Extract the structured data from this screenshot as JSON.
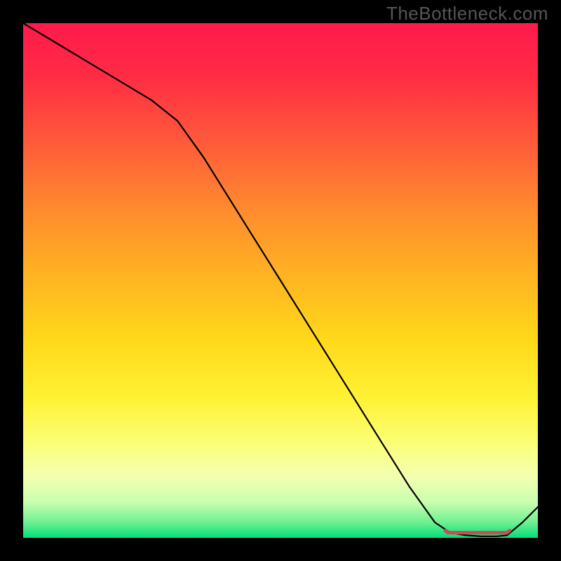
{
  "watermark": "TheBottleneck.com",
  "colors": {
    "marker_stroke": "#d24a5a",
    "curve_stroke": "#000000",
    "frame_bg": "#000000"
  },
  "chart_data": {
    "type": "line",
    "title": "",
    "xlabel": "",
    "ylabel": "",
    "xlim": [
      0,
      100
    ],
    "ylim": [
      0,
      100
    ],
    "grid": false,
    "legend": false,
    "series": [
      {
        "name": "curve",
        "x": [
          0,
          5,
          10,
          15,
          20,
          25,
          30,
          35,
          40,
          45,
          50,
          55,
          60,
          65,
          70,
          75,
          80,
          83,
          86,
          89,
          92,
          94,
          97,
          100
        ],
        "values": [
          100,
          97,
          94,
          91,
          88,
          85,
          81,
          74,
          66,
          58,
          50,
          42,
          34,
          26,
          18,
          10,
          3,
          1,
          0.5,
          0.3,
          0.3,
          0.5,
          3,
          6
        ]
      }
    ],
    "highlight_band": {
      "x_start": 82,
      "x_end": 94,
      "y": 1
    }
  }
}
